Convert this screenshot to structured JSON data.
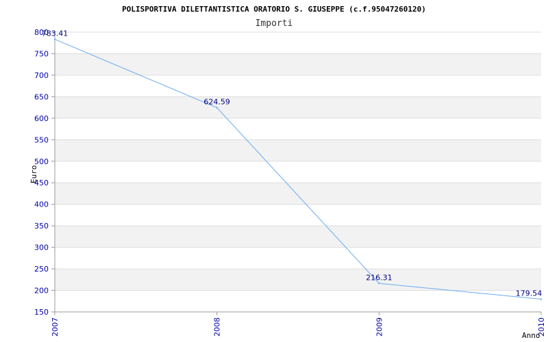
{
  "chart_data": {
    "type": "line",
    "title": "POLISPORTIVA DILETTANTISTICA ORATORIO S. GIUSEPPE (c.f.95047260120)",
    "subtitle": "Importi",
    "xlabel": "Anno",
    "ylabel": "Euro",
    "categories": [
      "2007",
      "2008",
      "2009",
      "2010"
    ],
    "series": [
      {
        "values": [
          783.41,
          624.59,
          216.31,
          179.54
        ],
        "color": "#6aaaf0"
      }
    ],
    "data_labels": [
      "783.41",
      "624.59",
      "216.31",
      "179.54"
    ],
    "ylim": [
      150,
      800
    ],
    "yticks": [
      "150",
      "200",
      "250",
      "300",
      "350",
      "400",
      "450",
      "500",
      "550",
      "600",
      "650",
      "700",
      "750",
      "800"
    ],
    "grid": true,
    "band_colors": [
      "#ffffff",
      "#f2f2f2"
    ],
    "axis_color": "#999999",
    "tick_color": "#0000aa"
  }
}
